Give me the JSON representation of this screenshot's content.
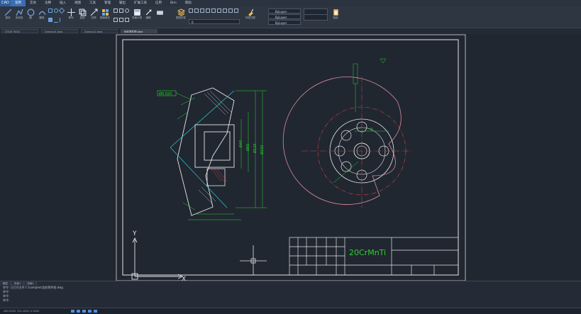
{
  "app": {
    "logo": "CAD"
  },
  "menu": [
    "常用",
    "实体",
    "注释",
    "插入",
    "视图",
    "工具",
    "管理",
    "输出",
    "扩展工具",
    "应用",
    "Bim",
    "帮助"
  ],
  "ribbon": {
    "tools": [
      {
        "label": "直线",
        "icon": "line-icon"
      },
      {
        "label": "多段线",
        "icon": "polyline-icon"
      },
      {
        "label": "圆",
        "icon": "circle-icon"
      },
      {
        "label": "圆弧",
        "icon": "arc-icon"
      },
      {
        "label": "移动",
        "icon": "move-icon"
      },
      {
        "label": "复制",
        "icon": "copy-icon"
      },
      {
        "label": "拉伸",
        "icon": "stretch-icon"
      },
      {
        "label": "图案填充",
        "icon": "hatch-icon"
      },
      {
        "label": "快速计算",
        "icon": "calc-icon"
      },
      {
        "label": "编辑",
        "icon": "edit-icon"
      },
      {
        "label": "图层特性",
        "icon": "layer-icon"
      },
      {
        "label": "特性匹配",
        "icon": "match-icon"
      },
      {
        "label": "粘贴",
        "icon": "paste-icon"
      }
    ],
    "groups": [
      "绘图",
      "修改",
      "注释",
      "图层",
      "块",
      "特性",
      "剪贴板"
    ],
    "layer_value": "0",
    "prop_values": [
      "ByLayer",
      "ByLayer",
      "ByLayer"
    ]
  },
  "tabs": [
    "START PAGE",
    "Drawing1.dwg",
    "Drawing2.dwg",
    "齿轮零件图.dwg"
  ],
  "drawing": {
    "datum_label": "Ø0.020",
    "material": "20CrMnTi",
    "axis_x": "X",
    "axis_y": "Y"
  },
  "layout_tabs": [
    "模型",
    "布局1",
    "布局2"
  ],
  "command": {
    "lines": [
      "命令: 已打开文件 C:\\samples\\齿轮零件图.dwg",
      "命令:",
      "命令:",
      "命令:"
    ]
  },
  "status": {
    "coords": "-483.5265, 331.2634, 0.0000"
  },
  "colors": {
    "green": "#2fd12f",
    "cyan": "#34d9d9",
    "red": "#d84545",
    "pink": "#e08a9e",
    "white": "#e6e6e6"
  }
}
